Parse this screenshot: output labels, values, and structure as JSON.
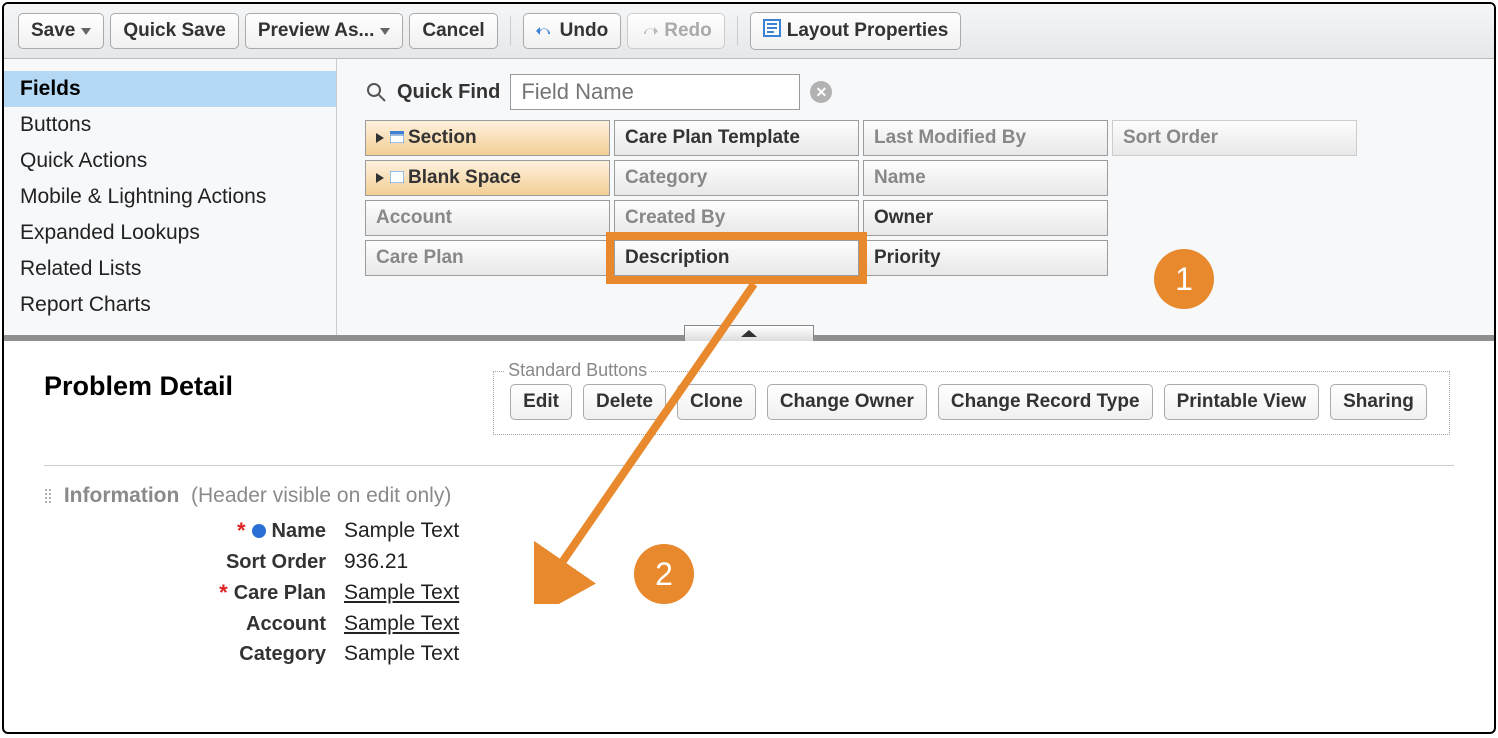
{
  "toolbar": {
    "save": "Save",
    "quick_save": "Quick Save",
    "preview_as": "Preview As...",
    "cancel": "Cancel",
    "undo": "Undo",
    "redo": "Redo",
    "layout_props": "Layout Properties"
  },
  "sidebar": {
    "items": [
      {
        "label": "Fields",
        "active": true
      },
      {
        "label": "Buttons"
      },
      {
        "label": "Quick Actions"
      },
      {
        "label": "Mobile & Lightning Actions"
      },
      {
        "label": "Expanded Lookups"
      },
      {
        "label": "Related Lists"
      },
      {
        "label": "Report Charts"
      }
    ]
  },
  "quickfind": {
    "label": "Quick Find",
    "placeholder": "Field Name"
  },
  "palette_fields": {
    "r0c0": "Section",
    "r0c1": "Care Plan Template",
    "r0c2": "Last Modified By",
    "r0c3": "Sort Order",
    "r1c0": "Blank Space",
    "r1c1": "Category",
    "r1c2": "Name",
    "r2c0": "Account",
    "r2c1": "Created By",
    "r2c2": "Owner",
    "r3c0": "Care Plan",
    "r3c1": "Description",
    "r3c2": "Priority"
  },
  "canvas": {
    "title": "Problem Detail",
    "std_buttons_legend": "Standard Buttons",
    "std_buttons": [
      "Edit",
      "Delete",
      "Clone",
      "Change Owner",
      "Change Record Type",
      "Printable View",
      "Sharing"
    ],
    "section_title": "Information",
    "section_sub": "(Header visible on edit only)",
    "rows": [
      {
        "label": "Name",
        "value": "Sample Text",
        "required": true,
        "blue": true,
        "link": false
      },
      {
        "label": "Sort Order",
        "value": "936.21",
        "required": false,
        "blue": false,
        "link": false
      },
      {
        "label": "Care Plan",
        "value": "Sample Text",
        "required": true,
        "blue": false,
        "link": true
      },
      {
        "label": "Account",
        "value": "Sample Text",
        "required": false,
        "blue": false,
        "link": true
      },
      {
        "label": "Category",
        "value": "Sample Text",
        "required": false,
        "blue": false,
        "link": false
      }
    ]
  },
  "annotations": {
    "n1": "1",
    "n2": "2"
  }
}
